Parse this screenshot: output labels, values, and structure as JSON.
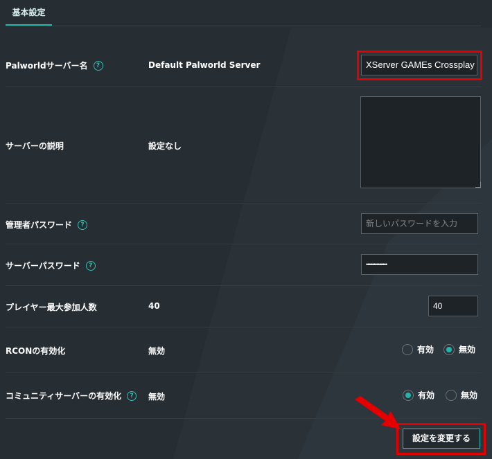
{
  "tabs": [
    {
      "label": "基本設定"
    }
  ],
  "form": {
    "server_name": {
      "label": "Palworldサーバー名",
      "current": "Default Palworld Server",
      "input_value": "XServer GAMEs Crossplay"
    },
    "server_description": {
      "label": "サーバーの説明",
      "current": "設定なし",
      "input_value": ""
    },
    "admin_password": {
      "label": "管理者パスワード",
      "placeholder": "新しいパスワードを入力"
    },
    "server_password": {
      "label": "サーバーパスワード",
      "masked_value": "••••••••••••••"
    },
    "max_players": {
      "label": "プレイヤー最大参加人数",
      "current": "40",
      "input_value": "40"
    },
    "rcon": {
      "label": "RCONの有効化",
      "current": "無効",
      "options": [
        "有効",
        "無効"
      ],
      "selected": "無効"
    },
    "community_server": {
      "label": "コミュニティサーバーの有効化",
      "current": "無効",
      "options": [
        "有効",
        "無効"
      ],
      "selected": "有効"
    },
    "help_icon_glyph": "?"
  },
  "actions": {
    "submit_label": "設定を変更する"
  },
  "colors": {
    "accent": "#23b4aa",
    "highlight": "#e50000",
    "background": "#262d33"
  }
}
